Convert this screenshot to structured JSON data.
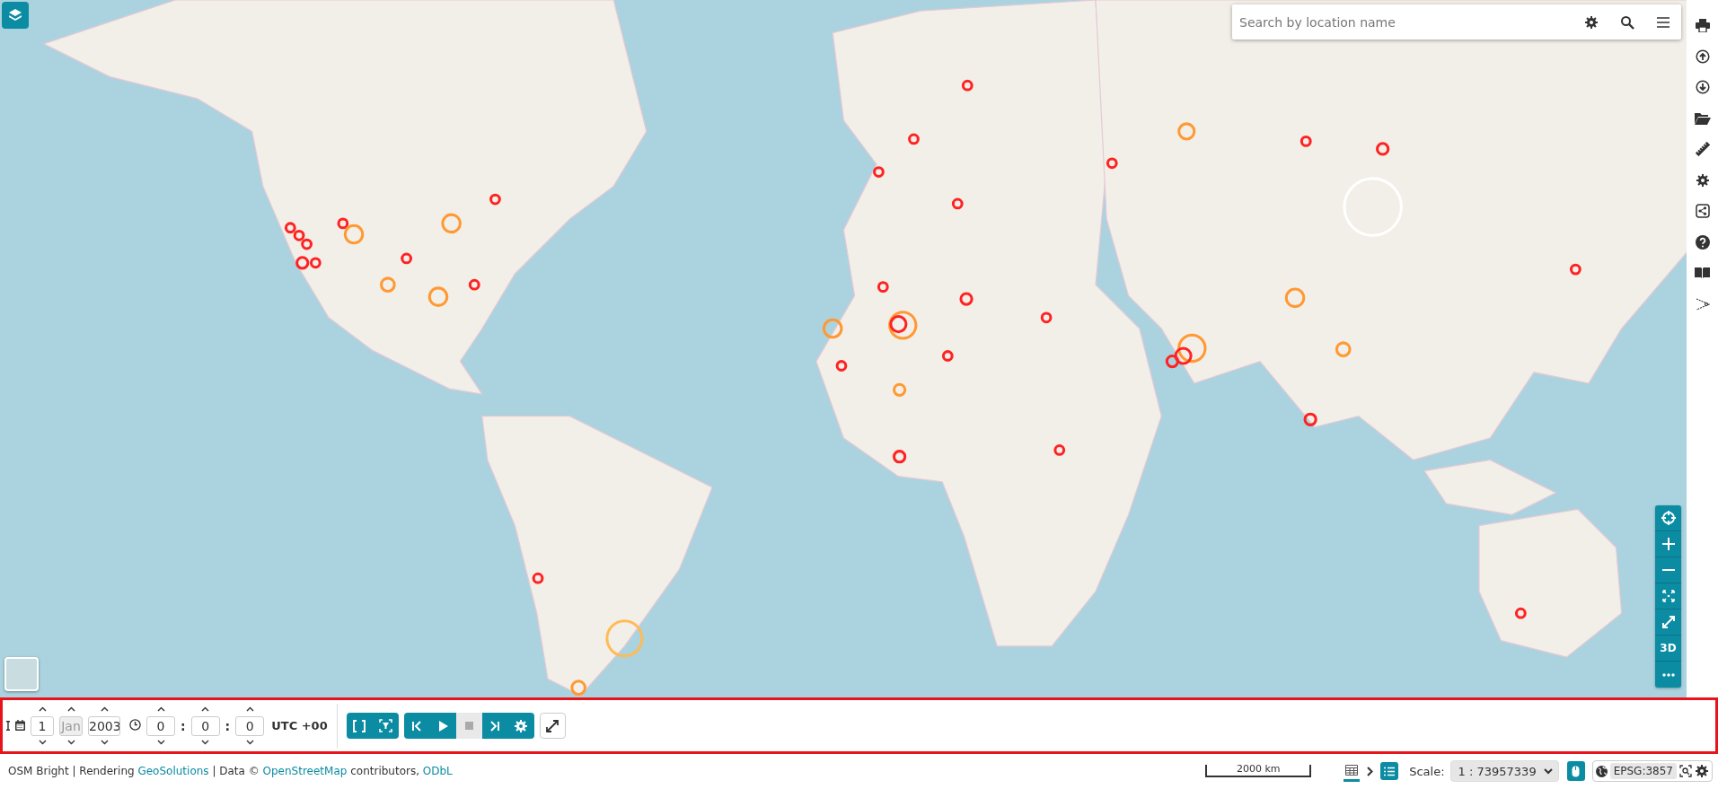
{
  "search": {
    "placeholder": "Search by location name"
  },
  "zoom_controls": {
    "label_3d": "3D"
  },
  "timeline": {
    "date_fields": [
      {
        "value": "1",
        "disabled": false
      },
      {
        "value": "Jan",
        "disabled": true
      },
      {
        "value": "2003",
        "disabled": false
      }
    ],
    "time_fields": [
      {
        "value": "0",
        "disabled": false
      },
      {
        "value": "0",
        "disabled": false
      },
      {
        "value": "0",
        "disabled": false
      }
    ],
    "time_separators": [
      ":",
      ":"
    ],
    "timezone": "UTC +00",
    "playback": [
      {
        "kind": "first",
        "disabled": false
      },
      {
        "kind": "play",
        "disabled": false
      },
      {
        "kind": "stop",
        "disabled": true
      },
      {
        "kind": "last",
        "disabled": false
      },
      {
        "kind": "settings",
        "disabled": false
      }
    ]
  },
  "attribution": [
    {
      "text": "OSM Bright | Rendering ",
      "link": false
    },
    {
      "text": "GeoSolutions",
      "link": true
    },
    {
      "text": " | Data © ",
      "link": false
    },
    {
      "text": "OpenStreetMap",
      "link": true
    },
    {
      "text": " contributors, ",
      "link": false
    },
    {
      "text": "ODbL",
      "link": true
    }
  ],
  "footer": {
    "scale_bar": "2000 km",
    "scale_label": "Scale:",
    "scale_value": "1 : 73957339",
    "crs": "EPSG:3857"
  }
}
